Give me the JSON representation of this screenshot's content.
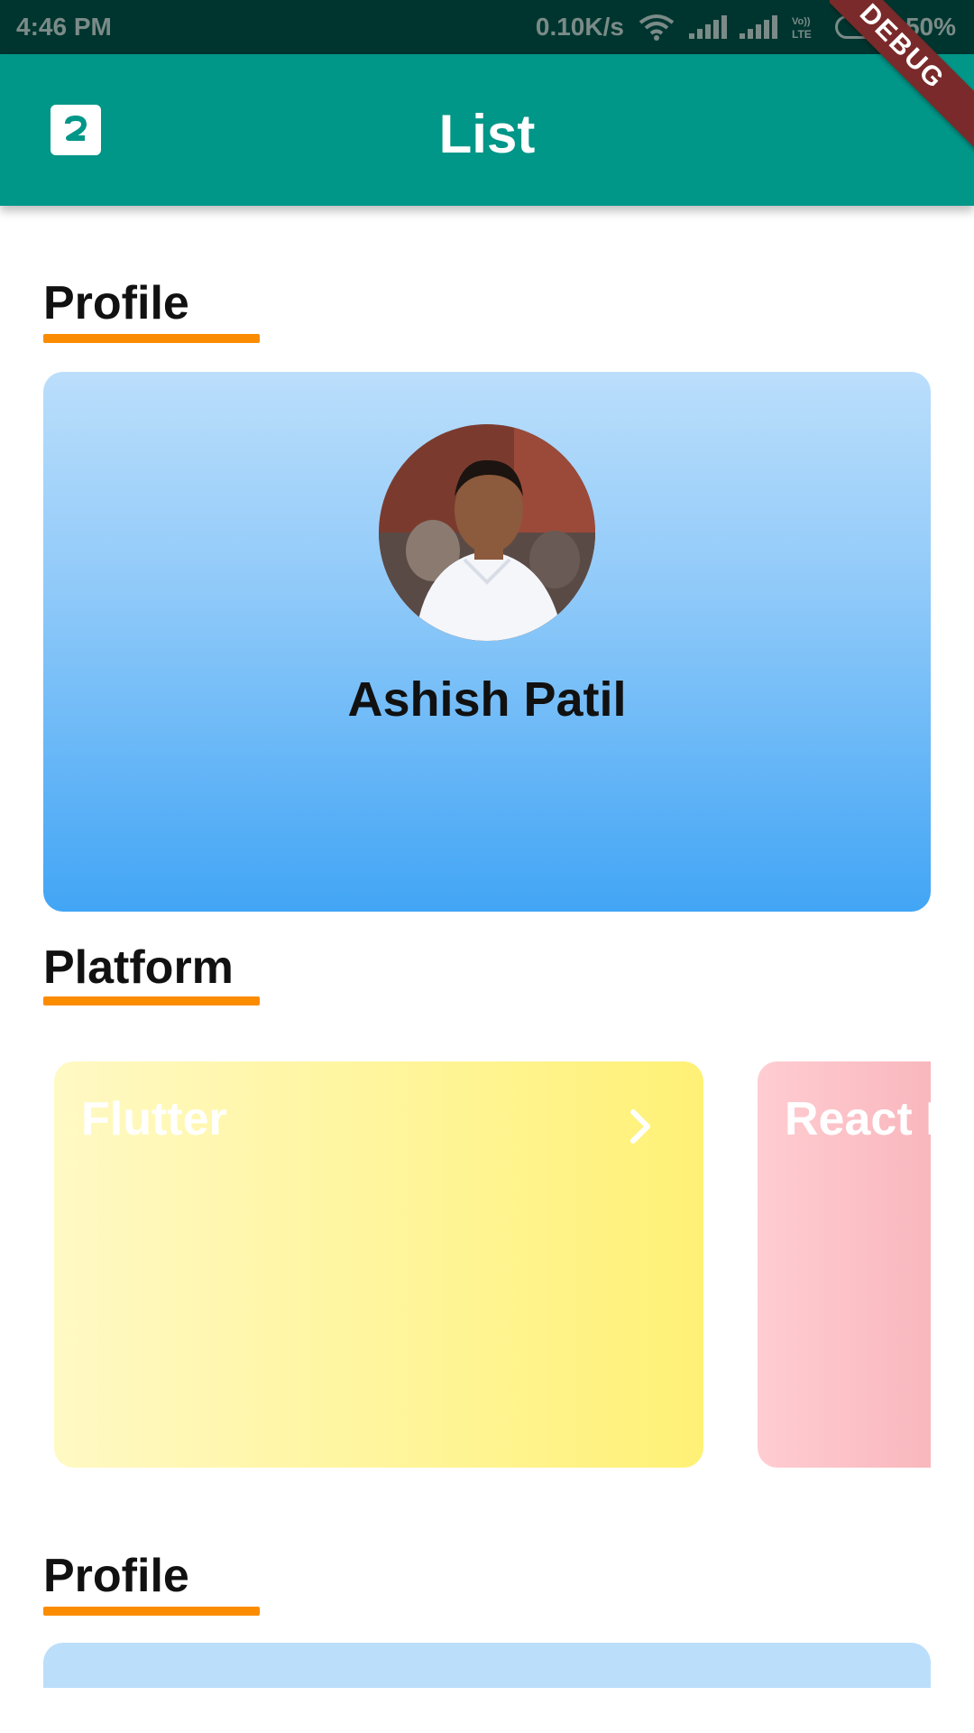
{
  "status_bar": {
    "time": "4:46 PM",
    "network_speed": "0.10K/s",
    "volte_label": "VoLTE",
    "battery": "50%"
  },
  "app_bar": {
    "title": "List",
    "icon": "app-logo-icon",
    "debug_label": "DEBUG",
    "background": "#009688"
  },
  "sections": [
    {
      "title": "Profile"
    },
    {
      "title": "Platform"
    },
    {
      "title": "Profile"
    }
  ],
  "profile": {
    "name": "Ashish Patil"
  },
  "platforms": [
    {
      "label": "Flutter",
      "icon": "chevron-right-icon"
    },
    {
      "label": "React N"
    }
  ],
  "colors": {
    "accent_underline": "#fb8c00",
    "status_bar": "#00352f",
    "profile_card_top": "#bbdefb",
    "profile_card_bottom": "#42a5f5",
    "flutter_card": "#fff176",
    "react_card": "#ffcdd2"
  }
}
